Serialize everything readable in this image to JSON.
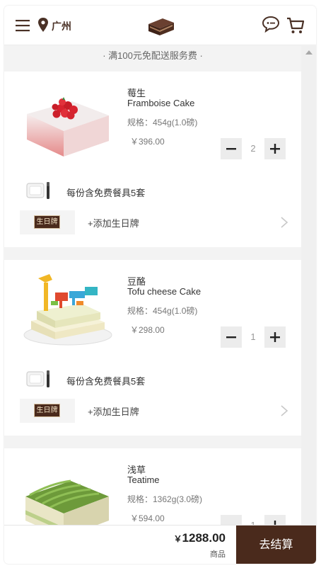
{
  "header": {
    "city": "广州",
    "icons": [
      "menu-icon",
      "location-pin-icon",
      "cake-logo-icon",
      "chat-icon",
      "cart-icon"
    ]
  },
  "notice": "· 满100元免配送服务费 ·",
  "items": [
    {
      "zh_name": "莓生",
      "en_name": "Framboise Cake",
      "spec": "规格：454g(1.0磅)",
      "price": "￥396.00",
      "qty": "2",
      "tableware": "每份含免费餐具5套",
      "bday_tag": "生日牌",
      "bday_add": "+添加生日牌"
    },
    {
      "zh_name": "豆酪",
      "en_name": "Tofu cheese Cake",
      "spec": "规格：454g(1.0磅)",
      "price": "￥298.00",
      "qty": "1",
      "tableware": "每份含免费餐具5套",
      "bday_tag": "生日牌",
      "bday_add": "+添加生日牌"
    },
    {
      "zh_name": "浅草",
      "en_name": "Teatime",
      "spec": "规格：1362g(3.0磅)",
      "price": "￥594.00",
      "qty": "1"
    }
  ],
  "footer": {
    "currency": "￥",
    "total": "1288.00",
    "sub": "商品",
    "checkout": "去结算"
  },
  "colors": {
    "brand_brown": "#4a2a1c",
    "background": "#f3f3f3"
  }
}
